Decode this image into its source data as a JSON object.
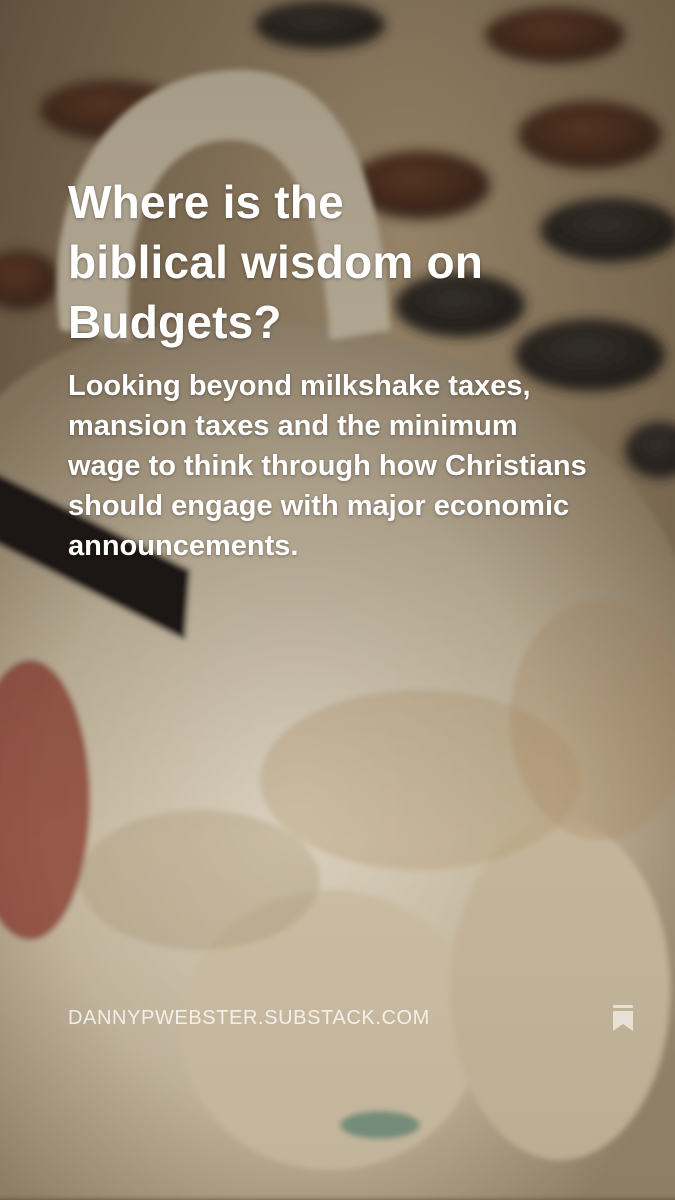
{
  "post": {
    "title": "Where is the biblical wisdom on Budgets?",
    "subtitle": "Looking beyond milkshake taxes, mansion taxes and the minimum wage to think through how Christians should engage with major economic announcements.",
    "publication_url": "DANNYPWEBSTER.SUBSTACK.COM"
  },
  "icons": {
    "bookmark": "bookmark-icon",
    "background": "piggy-bank-photo"
  },
  "colors": {
    "text": "#ffffff",
    "url_text": "#e8e1d6",
    "icon": "#e8e1d6"
  }
}
